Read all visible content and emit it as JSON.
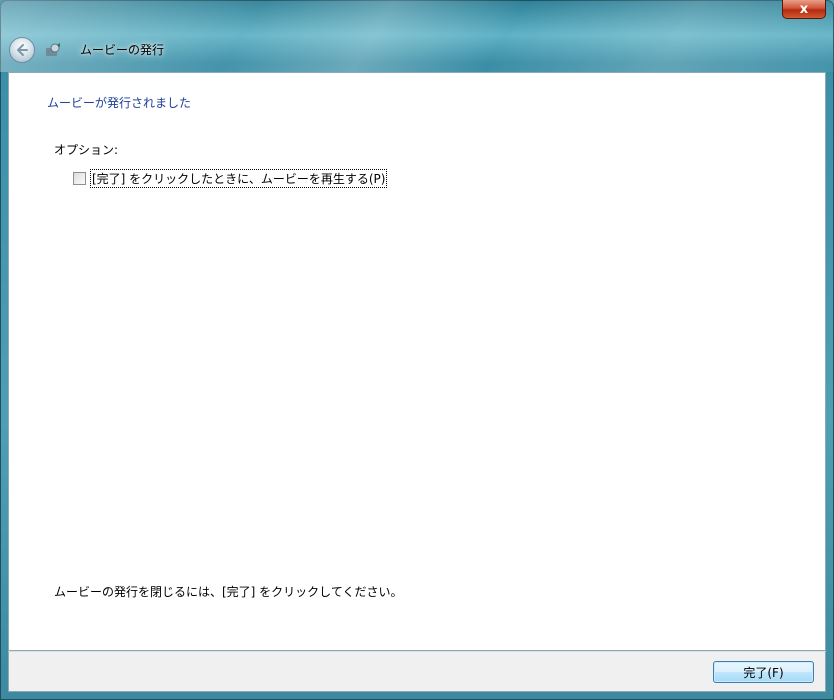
{
  "window": {
    "title": "ムービーの発行",
    "close_label": "x"
  },
  "content": {
    "heading": "ムービーが発行されました",
    "options_label": "オプション:",
    "checkbox_label": "[完了] をクリックしたときに、ムービーを再生する(P)",
    "checkbox_checked": false,
    "footer_text": "ムービーの発行を閉じるには、[完了] をクリックしてください。"
  },
  "buttons": {
    "finish_label": "完了(F)"
  },
  "icons": {
    "back": "back-arrow-icon",
    "app": "movie-publish-icon",
    "close": "close-icon"
  },
  "colors": {
    "heading": "#1e3f9a",
    "titlebar": "#3b8ea6"
  }
}
